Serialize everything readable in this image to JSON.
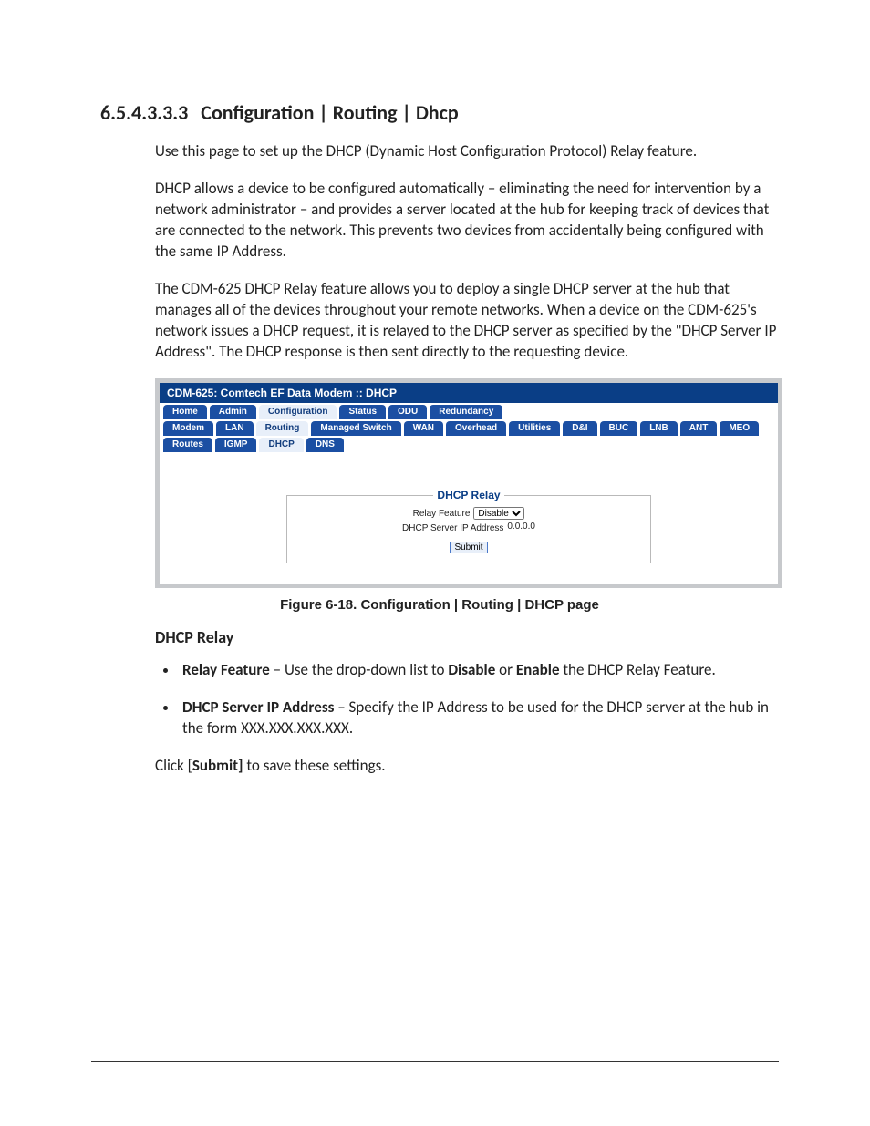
{
  "section": {
    "number": "6.5.4.3.3.3",
    "title": "Configuration | Routing | Dhcp"
  },
  "paragraphs": {
    "p1": "Use this page to set up the DHCP (Dynamic Host Configuration Protocol) Relay feature.",
    "p2": "DHCP allows a device to be configured automatically – eliminating the need for intervention by a network administrator – and provides a server located at the hub for keeping track of devices that are connected to the network. This prevents two devices from accidentally being configured with the same IP Address.",
    "p3": "The CDM-625 DHCP Relay feature allows you to deploy a single DHCP server at the hub that manages all of the devices throughout your remote networks. When a device on the CDM-625's network issues a DHCP request, it is relayed to the DHCP server as specified by the \"DHCP Server IP Address\". The DHCP response is then sent directly to the requesting device."
  },
  "figure": {
    "window_title": "CDM-625: Comtech EF Data Modem :: DHCP",
    "tabs_row1": [
      "Home",
      "Admin",
      "Configuration",
      "Status",
      "ODU",
      "Redundancy"
    ],
    "tabs_row1_active_index": 2,
    "tabs_row2": [
      "Modem",
      "LAN",
      "Routing",
      "Managed Switch",
      "WAN",
      "Overhead",
      "Utilities",
      "D&I",
      "BUC",
      "LNB",
      "ANT",
      "MEO"
    ],
    "tabs_row2_active_index": 2,
    "tabs_row3": [
      "Routes",
      "IGMP",
      "DHCP",
      "DNS"
    ],
    "tabs_row3_active_index": 2,
    "panel": {
      "title": "DHCP Relay",
      "relay_label": "Relay Feature",
      "relay_value": "Disable",
      "ip_label": "DHCP Server IP Address",
      "ip_value": "0.0.0.0",
      "submit": "Submit"
    },
    "caption": "Figure 6-18. Configuration | Routing | DHCP page"
  },
  "subsection": {
    "heading": "DHCP Relay",
    "bullets": {
      "b1_lead": "Relay Feature",
      "b1_mid": " – Use the drop-down list to ",
      "b1_opt1": "Disable",
      "b1_or": " or ",
      "b1_opt2": "Enable",
      "b1_tail": " the DHCP Relay Feature.",
      "b2_lead": "DHCP Server IP Address – ",
      "b2_tail": "Specify the IP Address to be used for the DHCP server at the hub in the form XXX.XXX.XXX.XXX."
    },
    "closing_pre": "Click [",
    "closing_bold": "Submit]",
    "closing_post": " to save these settings."
  }
}
